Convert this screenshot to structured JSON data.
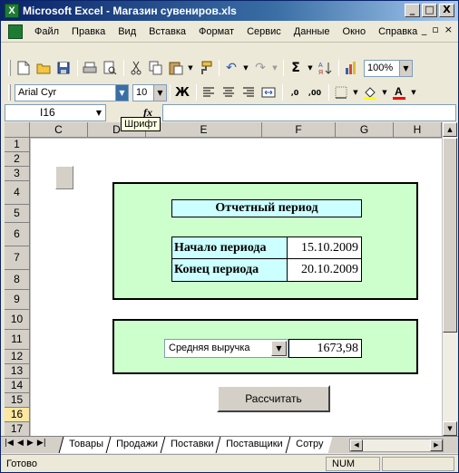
{
  "window": {
    "title": "Microsoft Excel - Магазин сувениров.xls",
    "app_icon_label": "X",
    "minimize": "_",
    "maximize": "□",
    "close": "X"
  },
  "menu": {
    "items": [
      "Файл",
      "Правка",
      "Вид",
      "Вставка",
      "Формат",
      "Сервис",
      "Данные",
      "Окно",
      "Справка"
    ],
    "doc_minimize": "_",
    "doc_restore": "▫",
    "doc_close": "×"
  },
  "toolbar_standard": {
    "zoom": "100%"
  },
  "toolbar_format": {
    "font_name": "Arial Cyr",
    "font_size": "10",
    "bold": "Ж"
  },
  "formula_bar": {
    "name_box": "I16",
    "fx": "fx",
    "tooltip": "Шрифт"
  },
  "columns": [
    "C",
    "D",
    "E",
    "F",
    "G",
    "H"
  ],
  "rows": [
    "1",
    "2",
    "3",
    "4",
    "5",
    "6",
    "7",
    "8",
    "9",
    "10",
    "11",
    "12",
    "13",
    "14",
    "15",
    "16",
    "17"
  ],
  "selected_row": "16",
  "report": {
    "title": "Отчетный период",
    "start_label": "Начало периода",
    "start_value": "15.10.2009",
    "end_label": "Конец периода",
    "end_value": "20.10.2009"
  },
  "revenue": {
    "selected_option": "Средняя выручка",
    "value": "1673,98"
  },
  "calc_button": "Рассчитать",
  "sheet_tabs": [
    "Товары",
    "Продажи",
    "Поставки",
    "Поставщики",
    "Сотру"
  ],
  "status": {
    "left": "Готово",
    "num": "NUM"
  },
  "colors": {
    "panel_green": "#ccffcc",
    "label_cyan": "#ccffff",
    "title_blue": "#0a246a"
  }
}
